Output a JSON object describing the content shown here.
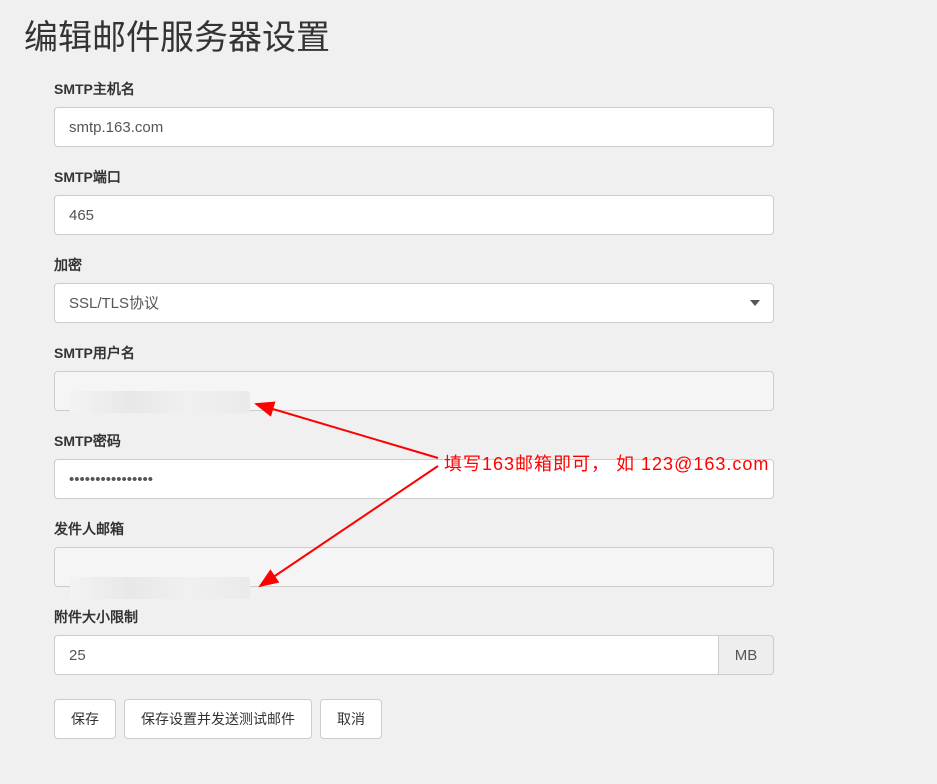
{
  "title": "编辑邮件服务器设置",
  "form": {
    "smtp_host": {
      "label": "SMTP主机名",
      "value": "smtp.163.com"
    },
    "smtp_port": {
      "label": "SMTP端口",
      "value": "465"
    },
    "encryption": {
      "label": "加密",
      "selected": "SSL/TLS协议"
    },
    "smtp_username": {
      "label": "SMTP用户名",
      "value": ""
    },
    "smtp_password": {
      "label": "SMTP密码",
      "value": "••••••••••••••••"
    },
    "sender_email": {
      "label": "发件人邮箱",
      "value": ""
    },
    "attachment_limit": {
      "label": "附件大小限制",
      "value": "25",
      "suffix": "MB"
    }
  },
  "buttons": {
    "save": "保存",
    "save_test": "保存设置并发送测试邮件",
    "cancel": "取消"
  },
  "annotation": "填写163邮箱即可， 如 123@163.com"
}
